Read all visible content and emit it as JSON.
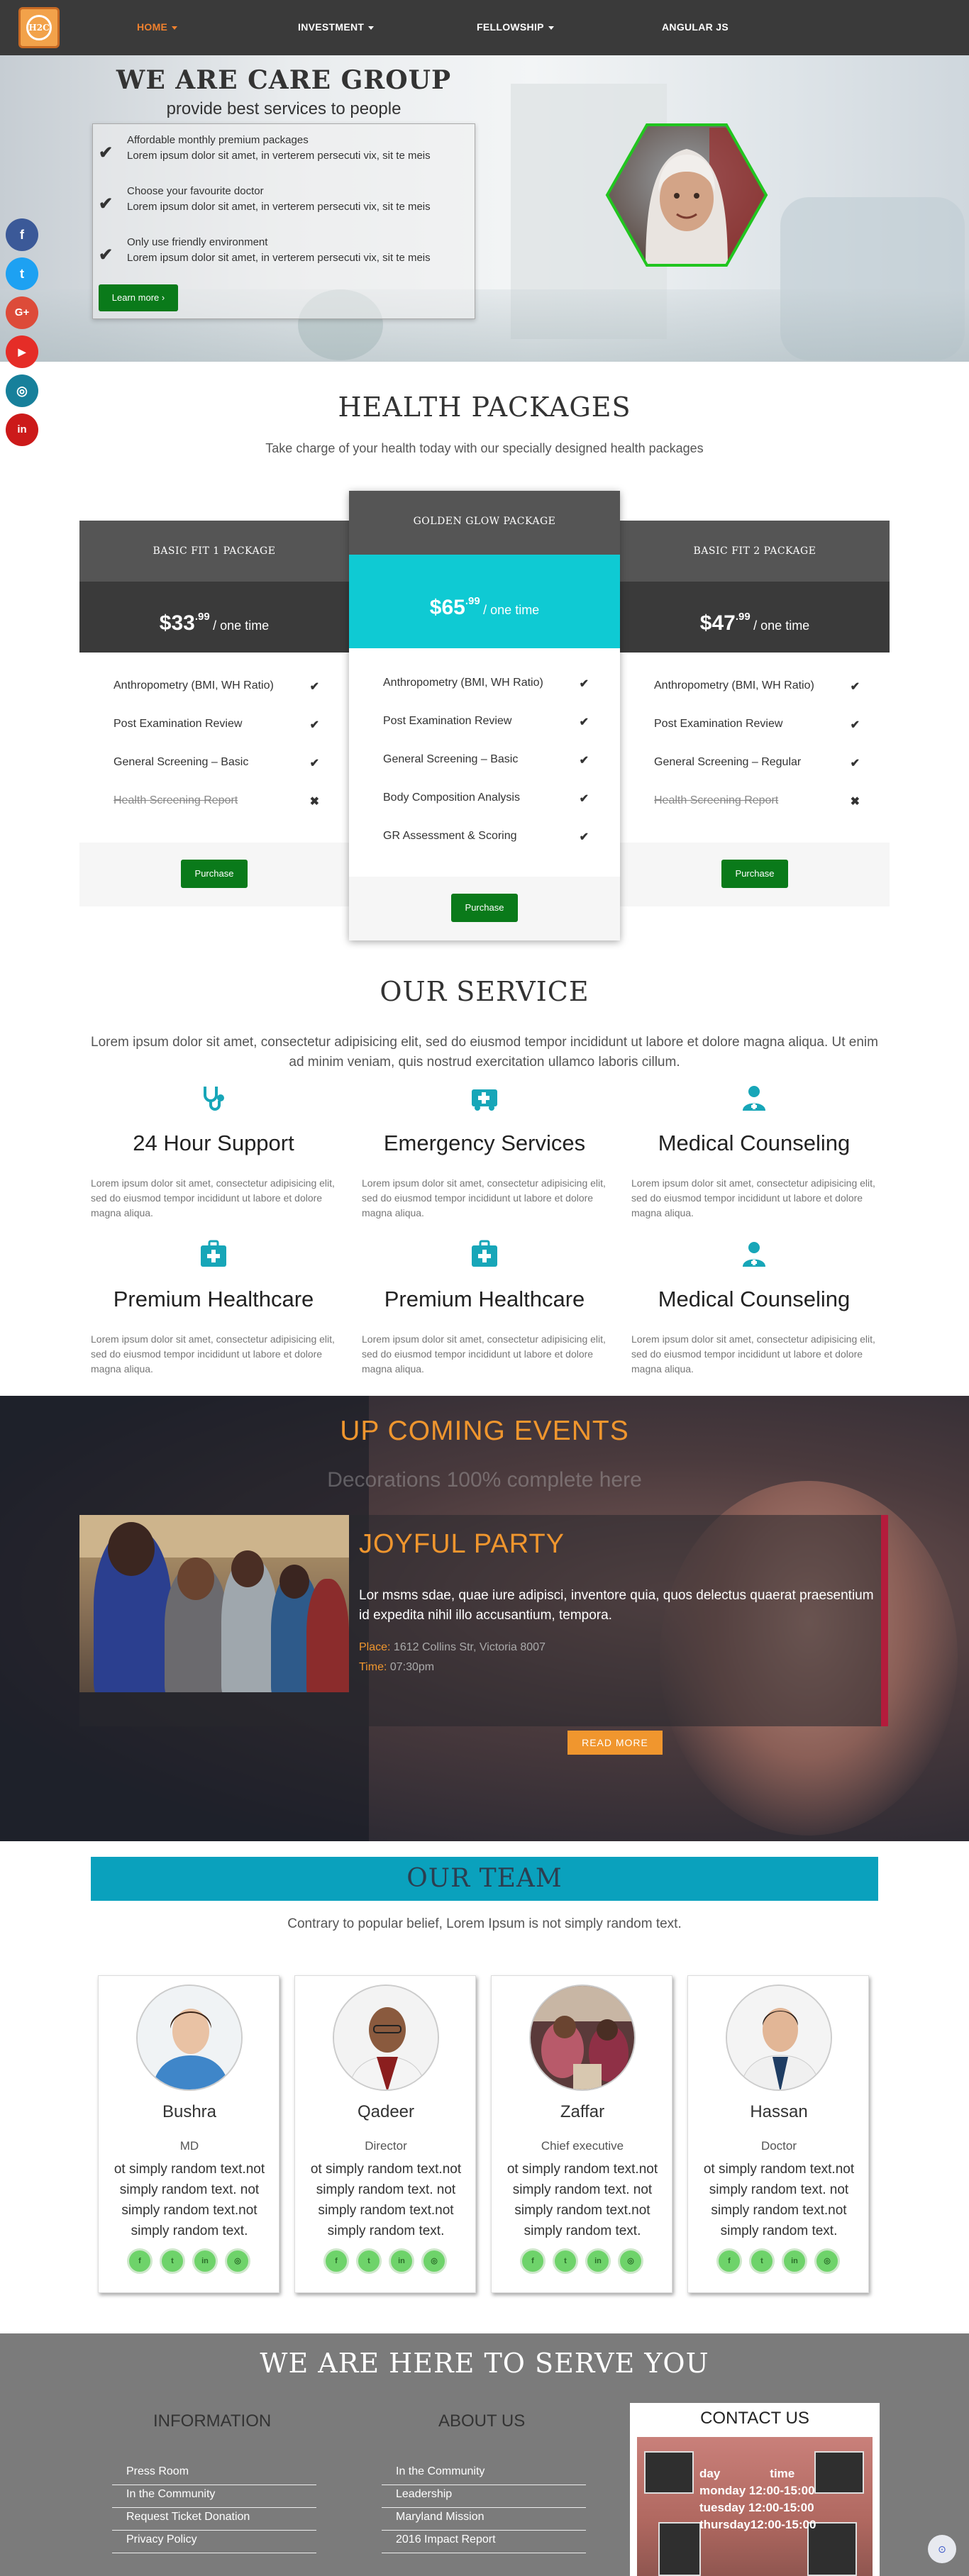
{
  "nav": {
    "logo_text": "H2C",
    "items": [
      {
        "label": "HOME",
        "dropdown": true,
        "active": true
      },
      {
        "label": "INVESTMENT",
        "dropdown": true
      },
      {
        "label": "FELLOWSHIP",
        "dropdown": true
      },
      {
        "label": "ANGULAR JS",
        "dropdown": false
      }
    ]
  },
  "social_sidebar": [
    {
      "icon": "facebook-icon",
      "glyph": "f",
      "color": "#3b5998"
    },
    {
      "icon": "twitter-icon",
      "glyph": "t",
      "color": "#1da1f2"
    },
    {
      "icon": "google-plus-icon",
      "glyph": "G+",
      "color": "#dd4b39"
    },
    {
      "icon": "youtube-icon",
      "glyph": "▶",
      "color": "#e52d27"
    },
    {
      "icon": "instagram-icon",
      "glyph": "◎",
      "color": "#17809b"
    },
    {
      "icon": "linkedin-icon",
      "glyph": "in",
      "color": "#cc1a1a"
    }
  ],
  "hero": {
    "title": "WE ARE CARE GROUP",
    "subtitle": "provide best services to people",
    "items": [
      {
        "title": "Affordable monthly premium packages",
        "text": "Lorem ipsum dolor sit amet, in verterem persecuti vix, sit te meis"
      },
      {
        "title": "Choose your favourite doctor",
        "text": "Lorem ipsum dolor sit amet, in verterem persecuti vix, sit te meis"
      },
      {
        "title": "Only use friendly environment",
        "text": "Lorem ipsum dolor sit amet, in verterem persecuti vix, sit te meis"
      }
    ],
    "cta": "Learn more ›"
  },
  "packages": {
    "title": "HEALTH PACKAGES",
    "subtitle": "Take charge of your health today with our specially designed health packages",
    "plans": [
      {
        "name": "BASIC FIT 1 PACKAGE",
        "dollars": "$33",
        "cents": ".99",
        "period": "/ one time",
        "features": [
          {
            "label": "Anthropometry (BMI, WH Ratio)",
            "included": true
          },
          {
            "label": "Post Examination Review",
            "included": true
          },
          {
            "label": "General Screening – Basic",
            "included": true
          },
          {
            "label": "Health Screening Report",
            "included": false
          }
        ],
        "button": "Purchase"
      },
      {
        "name": "GOLDEN GLOW PACKAGE",
        "dollars": "$65",
        "cents": ".99",
        "period": "/ one time",
        "features": [
          {
            "label": "Anthropometry (BMI, WH Ratio)",
            "included": true
          },
          {
            "label": "Post Examination Review",
            "included": true
          },
          {
            "label": "General Screening – Basic",
            "included": true
          },
          {
            "label": "Body Composition Analysis",
            "included": true
          },
          {
            "label": "GR Assessment & Scoring",
            "included": true
          }
        ],
        "button": "Purchase"
      },
      {
        "name": "BASIC FIT 2 PACKAGE",
        "dollars": "$47",
        "cents": ".99",
        "period": "/ one time",
        "features": [
          {
            "label": "Anthropometry (BMI, WH Ratio)",
            "included": true
          },
          {
            "label": "Post Examination Review",
            "included": true
          },
          {
            "label": "General Screening – Regular",
            "included": true
          },
          {
            "label": "Health Screening Report",
            "included": false
          }
        ],
        "button": "Purchase"
      }
    ]
  },
  "services": {
    "title": "OUR SERVICE",
    "intro": "Lorem ipsum dolor sit amet, consectetur adipisicing elit, sed do eiusmod tempor incididunt ut labore et dolore magna aliqua. Ut enim ad minim veniam, quis nostrud exercitation ullamco laboris cillum.",
    "items": [
      {
        "icon": "stethoscope-icon",
        "title": "24 Hour Support",
        "text": "Lorem ipsum dolor sit amet, consectetur adipisicing elit, sed do eiusmod tempor incididunt ut labore et dolore magna aliqua."
      },
      {
        "icon": "ambulance-icon",
        "title": "Emergency Services",
        "text": "Lorem ipsum dolor sit amet, consectetur adipisicing elit, sed do eiusmod tempor incididunt ut labore et dolore magna aliqua."
      },
      {
        "icon": "doctor-icon",
        "title": "Medical Counseling",
        "text": "Lorem ipsum dolor sit amet, consectetur adipisicing elit, sed do eiusmod tempor incididunt ut labore et dolore magna aliqua."
      },
      {
        "icon": "medkit-icon",
        "title": "Premium Healthcare",
        "text": "Lorem ipsum dolor sit amet, consectetur adipisicing elit, sed do eiusmod tempor incididunt ut labore et dolore magna aliqua."
      },
      {
        "icon": "medkit-icon",
        "title": "Premium Healthcare",
        "text": "Lorem ipsum dolor sit amet, consectetur adipisicing elit, sed do eiusmod tempor incididunt ut labore et dolore magna aliqua."
      },
      {
        "icon": "doctor-icon",
        "title": "Medical Counseling",
        "text": "Lorem ipsum dolor sit amet, consectetur adipisicing elit, sed do eiusmod tempor incididunt ut labore et dolore magna aliqua."
      }
    ],
    "accent": "#17a6b8"
  },
  "events": {
    "title": "UP COMING EVENTS",
    "subtitle": "Decorations 100% complete here",
    "event_name": "JOYFUL PARTY",
    "description": "Lor msms sdae, quae iure adipisci, inventore quia, quos delectus quaerat praesentium id expedita nihil illo accusantium, tempora.",
    "place_label": "Place:",
    "place": "1612 Collins Str, Victoria 8007",
    "time_label": "Time:",
    "time": "07:30pm",
    "button": "READ MORE"
  },
  "team": {
    "title": "OUR TEAM",
    "subtitle": "Contrary to popular belief, Lorem Ipsum is not simply random text.",
    "members": [
      {
        "name": "Bushra",
        "role": "MD",
        "bio": "ot simply random text.not simply random text. not simply random text.not simply random text."
      },
      {
        "name": "Qadeer",
        "role": "Director",
        "bio": "ot simply random text.not simply random text. not simply random text.not simply random text."
      },
      {
        "name": "Zaffar",
        "role": "Chief executive",
        "bio": "ot simply random text.not simply random text. not simply random text.not simply random text."
      },
      {
        "name": "Hassan",
        "role": "Doctor",
        "bio": "ot simply random text.not simply random text. not simply random text.not simply random text."
      }
    ],
    "social": [
      "f",
      "t",
      "in",
      "◎"
    ]
  },
  "footer": {
    "title": "WE ARE HERE TO SERVE YOU",
    "information": {
      "title": "INFORMATION",
      "links": [
        "Press Room",
        "In the Community",
        "Request Ticket Donation",
        "Privacy Policy"
      ]
    },
    "about": {
      "title": "ABOUT US",
      "links": [
        "In the Community",
        "Leadership",
        "Maryland Mission",
        "2016 Impact Report"
      ]
    },
    "contact": {
      "title": "CONTACT US",
      "hours_header": [
        "day",
        "time"
      ],
      "hours": [
        "monday 12:00-15:00",
        "tuesday 12:00-15:00",
        "thursday12:00-15:00"
      ]
    },
    "scroll_top": "⊙"
  }
}
